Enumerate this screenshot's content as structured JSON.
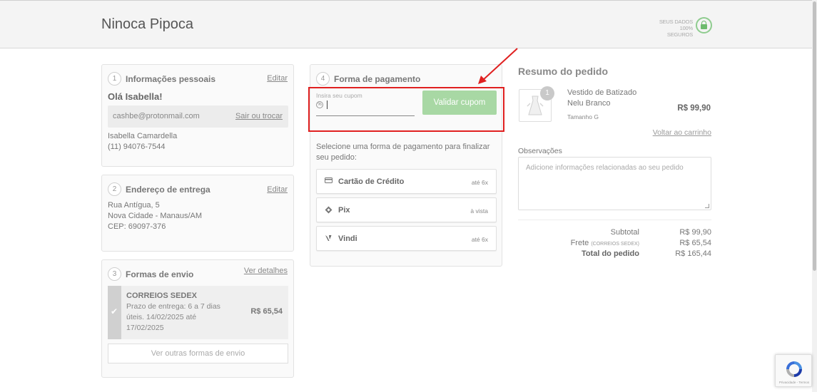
{
  "header": {
    "brand": "Ninoca Pipoca",
    "secure_line1": "SEUS DADOS",
    "secure_line2": "100% SEGUROS"
  },
  "personal": {
    "step": "1",
    "title": "Informações pessoais",
    "edit": "Editar",
    "greeting": "Olá Isabella!",
    "email": "cashbe@protonmail.com",
    "switch": "Sair ou trocar",
    "name": "Isabella Camardella",
    "phone": "(11) 94076-7544"
  },
  "address": {
    "step": "2",
    "title": "Endereço de entrega",
    "edit": "Editar",
    "line1": "Rua Antígua, 5",
    "line2": "Nova Cidade - Manaus/AM",
    "line3": "CEP: 69097-376"
  },
  "shipping": {
    "step": "3",
    "title": "Formas de envio",
    "details": "Ver detalhes",
    "option_name": "CORREIOS SEDEX",
    "option_desc": "Prazo de entrega: 6 a 7 dias úteis. 14/02/2025 até 17/02/2025",
    "option_price": "R$ 65,54",
    "more": "Ver outras formas de envio"
  },
  "payment": {
    "step": "4",
    "title": "Forma de pagamento",
    "coupon_label": "Insira seu cupom",
    "coupon_value": "",
    "coupon_icon": "%",
    "validate": "Validar cupom",
    "instructions": "Selecione uma forma de pagamento para finalizar seu pedido:",
    "options": [
      {
        "name": "Cartão de Crédito",
        "tag": "até 6x",
        "icon": "card-icon"
      },
      {
        "name": "Pix",
        "tag": "à vista",
        "icon": "pix-icon"
      },
      {
        "name": "Vindi",
        "tag": "até 6x",
        "icon": "vindi-icon"
      }
    ]
  },
  "summary": {
    "title": "Resumo do pedido",
    "product_qty": "1",
    "product_name_1": "Vestido de Batizado",
    "product_name_2": "Nelu Branco",
    "product_size": "Tamanho G",
    "product_price": "R$ 99,90",
    "back_to_cart": "Voltar ao carrinho",
    "obs_label": "Observações",
    "obs_placeholder": "Adicione informações relacionadas ao seu pedido",
    "subtotal_label": "Subtotal",
    "subtotal_value": "R$ 99,90",
    "frete_label": "Frete",
    "frete_carrier": "(CORREIOS SEDEX)",
    "frete_value": "R$ 65,54",
    "total_label": "Total do pedido",
    "total_value": "R$ 165,44"
  },
  "recaptcha": {
    "text": "Privacidade - Termos"
  },
  "colors": {
    "accent_green": "#a8d8a4",
    "highlight_red": "#e02020"
  }
}
